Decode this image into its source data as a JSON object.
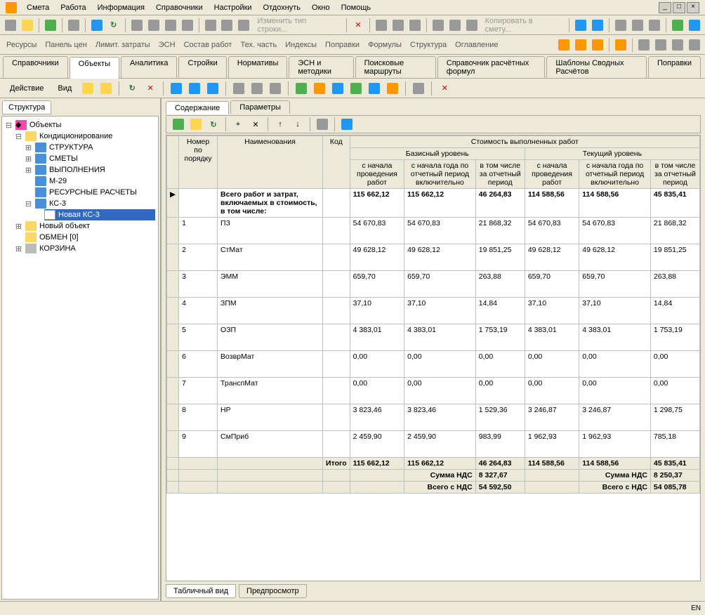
{
  "menu": [
    "Смета",
    "Работа",
    "Информация",
    "Справочники",
    "Настройки",
    "Отдохнуть",
    "Окно",
    "Помощь"
  ],
  "toolbar_text1": "Изменить тип строки...",
  "toolbar_text2": "Копировать в смету...",
  "linkbar": [
    "Ресурсы",
    "Панель цен",
    "Лимит. затраты",
    "ЭСН",
    "Состав работ",
    "Тех. часть",
    "Индексы",
    "Поправки",
    "Формулы",
    "Структура",
    "Оглавление"
  ],
  "main_tabs": [
    "Справочники",
    "Объекты",
    "Аналитика",
    "Стройки",
    "Нормативы",
    "ЭСН и методики",
    "Поисковые маршруты",
    "Справочник расчётных формул",
    "Шаблоны Сводных Расчётов",
    "Поправки"
  ],
  "main_tabs_active": 1,
  "action_labels": {
    "action": "Действие",
    "view": "Вид"
  },
  "sidebar_tab": "Структура",
  "tree": {
    "root": "Объекты",
    "kond": "Кондиционирование",
    "nodes": [
      "СТРУКТУРА",
      "СМЕТЫ",
      "ВЫПОЛНЕНИЯ",
      "М-29",
      "РЕСУРСНЫЕ РАСЧЕТЫ",
      "КС-3"
    ],
    "ks3_child": "Новая КС-3",
    "novy": "Новый объект",
    "obmen": "ОБМЕН  [0]",
    "korzina": "КОРЗИНА"
  },
  "content_tabs": [
    "Содержание",
    "Параметры"
  ],
  "content_tabs_active": 0,
  "grid": {
    "supertitle": "Стоимость выполненных работ",
    "group1": "Базисный уровень",
    "group2": "Текущий уровень",
    "h_num": "Номер по порядку",
    "h_name": "Наименования",
    "h_code": "Код",
    "h_c1": "с начала проведения работ",
    "h_c2": "с начала года по отчетный период включительно",
    "h_c3": "в том числе за отчетный период",
    "total_row_name": "Всего работ и затрат, включаемых в стоимость, в том числе:",
    "itogo": "Итого",
    "nds_label": "Сумма НДС",
    "vsego_nds": "Всего с НДС",
    "rows": [
      {
        "n": "",
        "name": "total",
        "c1": "115 662,12",
        "c2": "115 662,12",
        "c3": "46 264,83",
        "c4": "114 588,56",
        "c5": "114 588,56",
        "c6": "45 835,41"
      },
      {
        "n": "1",
        "name": "ПЗ",
        "c1": "54 670,83",
        "c2": "54 670,83",
        "c3": "21 868,32",
        "c4": "54 670,83",
        "c5": "54 670,83",
        "c6": "21 868,32"
      },
      {
        "n": "2",
        "name": "СтМат",
        "c1": "49 628,12",
        "c2": "49 628,12",
        "c3": "19 851,25",
        "c4": "49 628,12",
        "c5": "49 628,12",
        "c6": "19 851,25"
      },
      {
        "n": "3",
        "name": "ЭММ",
        "c1": "659,70",
        "c2": "659,70",
        "c3": "263,88",
        "c4": "659,70",
        "c5": "659,70",
        "c6": "263,88"
      },
      {
        "n": "4",
        "name": "ЗПМ",
        "c1": "37,10",
        "c2": "37,10",
        "c3": "14,84",
        "c4": "37,10",
        "c5": "37,10",
        "c6": "14,84"
      },
      {
        "n": "5",
        "name": "ОЗП",
        "c1": "4 383,01",
        "c2": "4 383,01",
        "c3": "1 753,19",
        "c4": "4 383,01",
        "c5": "4 383,01",
        "c6": "1 753,19"
      },
      {
        "n": "6",
        "name": "ВозврМат",
        "c1": "0,00",
        "c2": "0,00",
        "c3": "0,00",
        "c4": "0,00",
        "c5": "0,00",
        "c6": "0,00"
      },
      {
        "n": "7",
        "name": "ТранспМат",
        "c1": "0,00",
        "c2": "0,00",
        "c3": "0,00",
        "c4": "0,00",
        "c5": "0,00",
        "c6": "0,00"
      },
      {
        "n": "8",
        "name": "НР",
        "c1": "3 823,46",
        "c2": "3 823,46",
        "c3": "1 529,36",
        "c4": "3 246,87",
        "c5": "3 246,87",
        "c6": "1 298,75"
      },
      {
        "n": "9",
        "name": "СмПриб",
        "c1": "2 459,90",
        "c2": "2 459,90",
        "c3": "983,99",
        "c4": "1 962,93",
        "c5": "1 962,93",
        "c6": "785,18"
      }
    ],
    "itogo_vals": [
      "115 662,12",
      "115 662,12",
      "46 264,83",
      "114 588,56",
      "114 588,56",
      "45 835,41"
    ],
    "nds_vals": [
      "8 327,67",
      "8 250,37"
    ],
    "vsego_vals": [
      "54 592,50",
      "54 085,78"
    ]
  },
  "bottom_tabs": [
    "Табличный вид",
    "Предпросмотр"
  ],
  "status_lang": "EN"
}
